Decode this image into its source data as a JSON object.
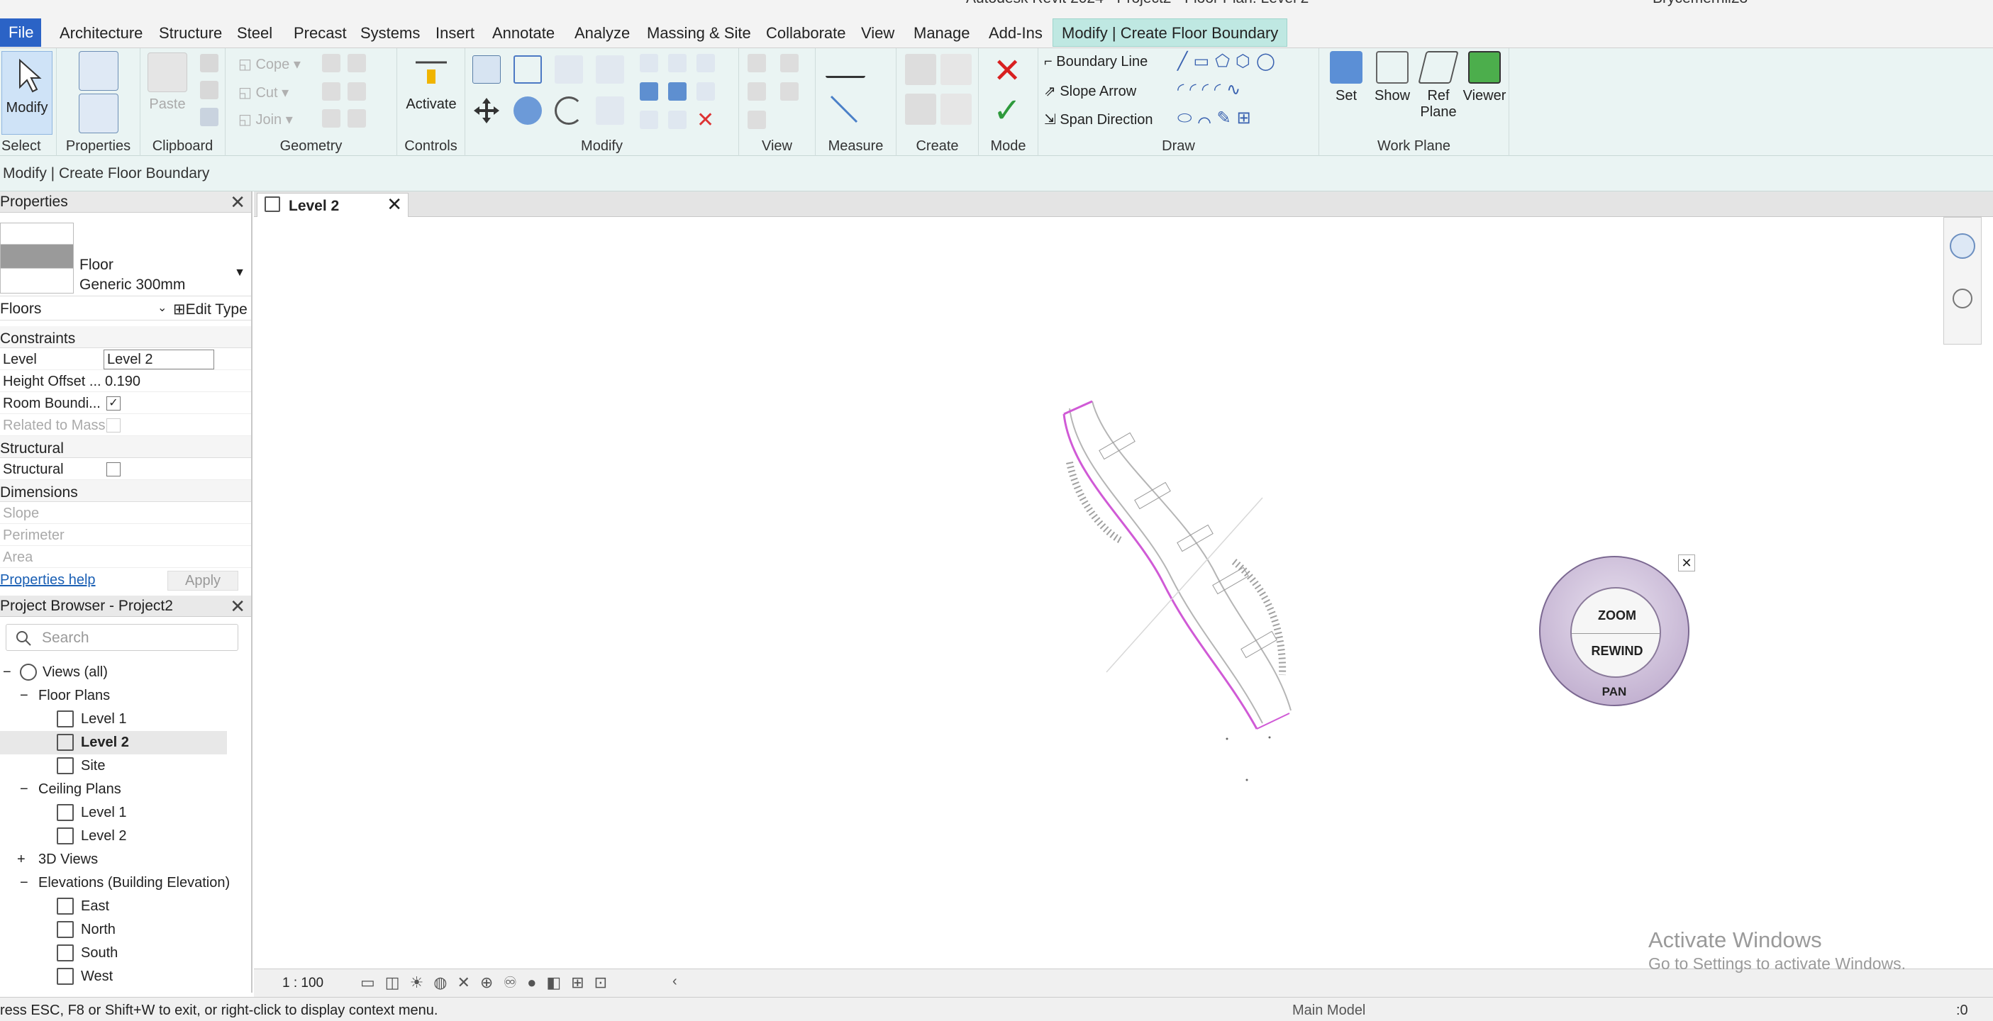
{
  "titlebar": {
    "title": "Autodesk Revit 2024 - Project2 - Floor Plan: Level 2",
    "user": "Brycemerrill23"
  },
  "tabs": [
    {
      "label": "File"
    },
    {
      "label": "Architecture"
    },
    {
      "label": "Structure"
    },
    {
      "label": "Steel"
    },
    {
      "label": "Precast"
    },
    {
      "label": "Systems"
    },
    {
      "label": "Insert"
    },
    {
      "label": "Annotate"
    },
    {
      "label": "Analyze"
    },
    {
      "label": "Massing & Site"
    },
    {
      "label": "Collaborate"
    },
    {
      "label": "View"
    },
    {
      "label": "Manage"
    },
    {
      "label": "Add-Ins"
    },
    {
      "label": "Modify | Create Floor Boundary"
    }
  ],
  "ribbon": {
    "select": {
      "modify": "Modify",
      "panel": "Select"
    },
    "properties": {
      "panel": "Properties"
    },
    "clipboard": {
      "paste": "Paste",
      "panel": "Clipboard"
    },
    "geometry": {
      "cope": "Cope",
      "cut": "Cut",
      "join": "Join",
      "panel": "Geometry"
    },
    "controls": {
      "activate": "Activate",
      "panel": "Controls"
    },
    "modify": {
      "panel": "Modify"
    },
    "view": {
      "panel": "View"
    },
    "measure": {
      "panel": "Measure"
    },
    "create": {
      "panel": "Create"
    },
    "mode": {
      "panel": "Mode"
    },
    "draw": {
      "boundary_line": "Boundary Line",
      "slope_arrow": "Slope Arrow",
      "span_direction": "Span Direction",
      "panel": "Draw"
    },
    "work_plane": {
      "set": "Set",
      "show": "Show",
      "ref": "Ref",
      "plane": "Plane",
      "viewer": "Viewer",
      "panel": "Work Plane"
    }
  },
  "options_bar": {
    "text": "Modify | Create Floor Boundary"
  },
  "properties": {
    "title": "Properties",
    "type_family": "Floor",
    "type_name": "Generic 300mm",
    "selector": "Floors",
    "edit_type": "Edit Type",
    "groups": {
      "constraints": "Constraints",
      "structural": "Structural",
      "dimensions": "Dimensions"
    },
    "rows": {
      "level_k": "Level",
      "level_v": "Level 2",
      "height_k": "Height Offset ...",
      "height_v": "0.190",
      "room_k": "Room Boundi...",
      "related_k": "Related to Mass",
      "structural_k": "Structural",
      "slope_k": "Slope",
      "perimeter_k": "Perimeter",
      "area_k": "Area"
    },
    "help": "Properties help",
    "apply": "Apply"
  },
  "browser": {
    "title": "Project Browser - Project2",
    "search_placeholder": "Search",
    "nodes": {
      "views_all": "Views (all)",
      "floor_plans": "Floor Plans",
      "fp_l1": "Level 1",
      "fp_l2": "Level 2",
      "fp_site": "Site",
      "ceiling_plans": "Ceiling Plans",
      "cp_l1": "Level 1",
      "cp_l2": "Level 2",
      "views_3d": "3D Views",
      "elevations": "Elevations (Building Elevation)",
      "east": "East",
      "north": "North",
      "south": "South",
      "west": "West"
    }
  },
  "view_tab": {
    "label": "Level 2"
  },
  "wheel": {
    "zoom": "ZOOM",
    "rewind": "REWIND",
    "pan": "PAN"
  },
  "view_control": {
    "scale": "1 : 100"
  },
  "watermark": {
    "line1": "Activate Windows",
    "line2": "Go to Settings to activate Windows."
  },
  "status": {
    "message": "ress ESC, F8 or Shift+W to exit, or right-click to display context menu.",
    "model": "Main Model",
    "filter": ":0"
  },
  "colors": {
    "accent": "#2b63c6",
    "ribbon_bg": "#eaf4f3",
    "active_tab": "#bfe8e2",
    "boundary": "#d05ad6"
  }
}
